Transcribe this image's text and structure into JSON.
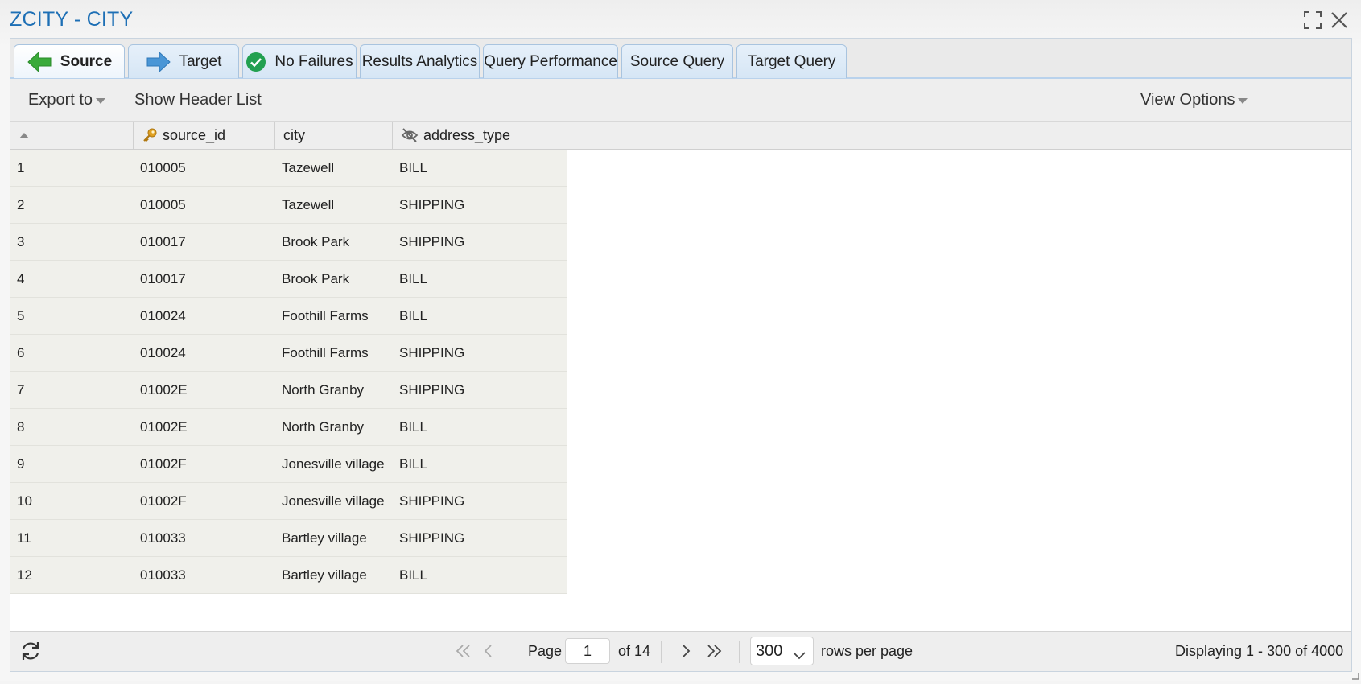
{
  "window": {
    "title": "ZCITY - CITY"
  },
  "tabs": [
    {
      "label": "Source",
      "icon": "arrow-left-icon",
      "active": true
    },
    {
      "label": "Target",
      "icon": "arrow-right-icon",
      "active": false
    },
    {
      "label": "No Failures",
      "icon": "check-circle-icon",
      "active": false
    },
    {
      "label": "Results Analytics",
      "active": false
    },
    {
      "label": "Query Performance",
      "active": false
    },
    {
      "label": "Source Query",
      "active": false
    },
    {
      "label": "Target Query",
      "active": false
    }
  ],
  "toolbar": {
    "export_label": "Export to",
    "header_list_label": "Show Header List",
    "view_options_label": "View Options"
  },
  "columns": [
    {
      "label": "",
      "icon": "sort-up-icon"
    },
    {
      "label": "source_id",
      "icon": "key-icon"
    },
    {
      "label": "city"
    },
    {
      "label": "address_type",
      "icon": "eye-off-icon"
    }
  ],
  "rows": [
    [
      "1",
      "010005",
      "Tazewell",
      "BILL"
    ],
    [
      "2",
      "010005",
      "Tazewell",
      "SHIPPING"
    ],
    [
      "3",
      "010017",
      "Brook Park",
      "SHIPPING"
    ],
    [
      "4",
      "010017",
      "Brook Park",
      "BILL"
    ],
    [
      "5",
      "010024",
      "Foothill Farms",
      "BILL"
    ],
    [
      "6",
      "010024",
      "Foothill Farms",
      "SHIPPING"
    ],
    [
      "7",
      "01002E",
      "North Granby",
      "SHIPPING"
    ],
    [
      "8",
      "01002E",
      "North Granby",
      "BILL"
    ],
    [
      "9",
      "01002F",
      "Jonesville village",
      "BILL"
    ],
    [
      "10",
      "01002F",
      "Jonesville village",
      "SHIPPING"
    ],
    [
      "11",
      "010033",
      "Bartley village",
      "SHIPPING"
    ],
    [
      "12",
      "010033",
      "Bartley village",
      "BILL"
    ]
  ],
  "pagination": {
    "page_label": "Page",
    "page_value": "1",
    "of_label": "of 14",
    "rows_per_page_value": "300",
    "rows_per_page_label": "rows per page",
    "display_text": "Displaying 1 - 300 of 4000"
  },
  "colors": {
    "title": "#1d6fb5",
    "tab_bg": "#d6e6f5",
    "arrow_green": "#3aaa3a",
    "arrow_blue": "#4a96d6",
    "check_green": "#22a050",
    "row_bg": "#f0f0eb"
  }
}
